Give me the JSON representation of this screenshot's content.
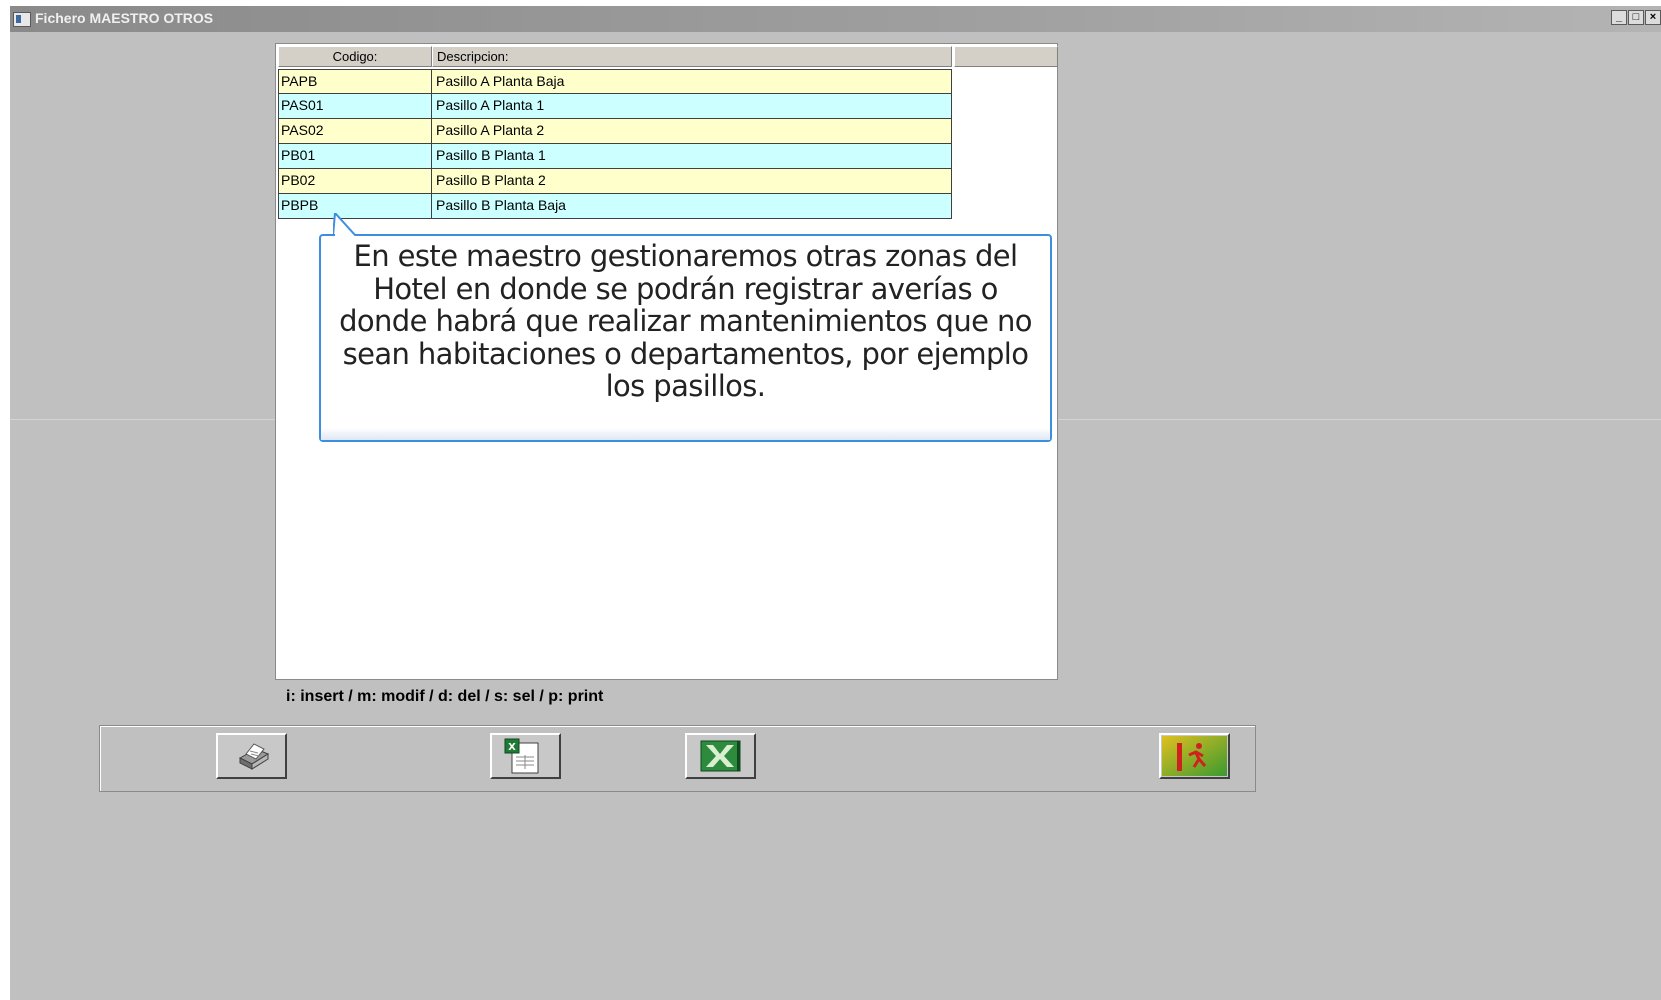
{
  "window": {
    "title": "Fichero MAESTRO OTROS"
  },
  "grid": {
    "columns": [
      "Codigo:",
      "Descripcion:"
    ],
    "rows": [
      {
        "code": "PAPB",
        "description": "Pasillo A Planta Baja"
      },
      {
        "code": "PAS01",
        "description": "Pasillo A Planta 1"
      },
      {
        "code": "PAS02",
        "description": "Pasillo A Planta 2"
      },
      {
        "code": "PB01",
        "description": "Pasillo B Planta 1"
      },
      {
        "code": "PB02",
        "description": "Pasillo B Planta 2"
      },
      {
        "code": "PBPB",
        "description": "Pasillo B Planta Baja"
      }
    ],
    "row_colors": [
      "#ffffcc",
      "#ccffff"
    ]
  },
  "callout": {
    "text": "En este maestro gestionaremos otras zonas del Hotel en donde se podrán registrar averías o donde habrá que realizar mantenimientos que no sean habitaciones o departamentos, por ejemplo los pasillos."
  },
  "hint": "i: insert / m: modif / d: del / s: sel / p: print",
  "toolbar": {
    "buttons": [
      {
        "icon": "printer-icon"
      },
      {
        "icon": "excel-document-icon"
      },
      {
        "icon": "excel-icon"
      },
      {
        "icon": "exit-icon"
      }
    ]
  },
  "colors": {
    "accent": "#3d8ee0",
    "window_bg": "#c0c0c0"
  }
}
